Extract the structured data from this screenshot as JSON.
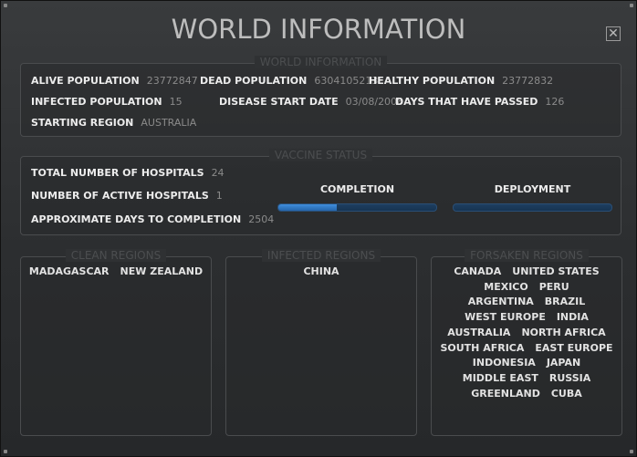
{
  "window": {
    "title": "WORLD INFORMATION",
    "close_glyph": "✕"
  },
  "world_info": {
    "legend": "WORLD INFORMATION",
    "alive_label": "ALIVE POPULATION",
    "alive_value": "23772847",
    "dead_label": "DEAD POPULATION",
    "dead_value": "6304105213",
    "healthy_label": "HEALTHY POPULATION",
    "healthy_value": "23772832",
    "infected_label": "INFECTED POPULATION",
    "infected_value": "15",
    "start_date_label": "DISEASE START DATE",
    "start_date_value": "03/08/2008",
    "days_label": "DAYS THAT HAVE PASSED",
    "days_value": "126",
    "region_label": "STARTING REGION",
    "region_value": "AUSTRALIA"
  },
  "vaccine": {
    "legend": "VACCINE STATUS",
    "hospitals_label": "TOTAL NUMBER OF HOSPITALS",
    "hospitals_value": "24",
    "active_label": "NUMBER OF ACTIVE HOSPITALS",
    "active_value": "1",
    "days_label": "APPROXIMATE DAYS TO COMPLETION",
    "days_value": "2504",
    "completion_label": "COMPLETION",
    "completion_progress": 0.37,
    "deployment_label": "DEPLOYMENT",
    "deployment_progress": 0,
    "accent_color": "#3f8edc"
  },
  "regions": {
    "clean": {
      "legend": "CLEAN REGIONS",
      "lines": [
        [
          "MADAGASCAR",
          "NEW ZEALAND"
        ]
      ]
    },
    "infected": {
      "legend": "INFECTED REGIONS",
      "lines": [
        [
          "CHINA"
        ]
      ]
    },
    "forsaken": {
      "legend": "FORSAKEN REGIONS",
      "lines": [
        [
          "CANADA",
          "UNITED STATES"
        ],
        [
          "MEXICO",
          "PERU"
        ],
        [
          "ARGENTINA",
          "BRAZIL"
        ],
        [
          "WEST EUROPE",
          "INDIA"
        ],
        [
          "AUSTRALIA",
          "NORTH AFRICA"
        ],
        [
          "SOUTH AFRICA",
          "EAST EUROPE"
        ],
        [
          "INDONESIA",
          "JAPAN"
        ],
        [
          "MIDDLE EAST",
          "RUSSIA"
        ],
        [
          "GREENLAND",
          "CUBA"
        ]
      ]
    }
  }
}
